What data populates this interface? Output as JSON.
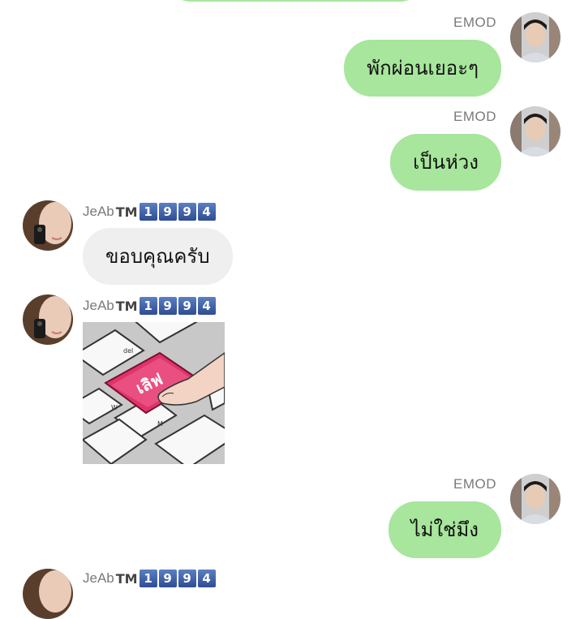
{
  "messages": [
    {
      "sender": "EMOD",
      "text": "พักผ่อนเยอะๆ"
    },
    {
      "sender": "EMOD",
      "text": "เป็นห่วง"
    },
    {
      "sender": "JeAb",
      "sender_suffix": "TM",
      "sender_digits": [
        "1",
        "9",
        "9",
        "4"
      ],
      "text": "ขอบคุณครับ"
    },
    {
      "sender": "JeAb",
      "sender_suffix": "TM",
      "sender_digits": [
        "1",
        "9",
        "9",
        "4"
      ],
      "sticker_text": "เลิฟ",
      "sticker_icon": "keyboard-key-sticker",
      "keys": [
        "W",
        "M",
        "del"
      ]
    },
    {
      "sender": "EMOD",
      "text": "ไม่ใช่มึง"
    },
    {
      "sender": "JeAb",
      "sender_suffix": "TM",
      "sender_digits": [
        "1",
        "9",
        "9",
        "4"
      ]
    }
  ],
  "colors": {
    "outgoing_bubble": "#a7e69c",
    "incoming_bubble": "#efefef",
    "sticker_key": "#e0336a"
  }
}
